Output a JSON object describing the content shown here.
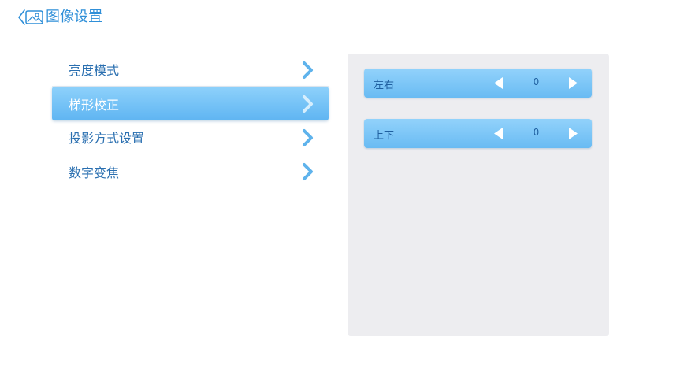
{
  "header": {
    "title": "图像设置",
    "back_icon": "back-image-icon"
  },
  "menu": {
    "items": [
      {
        "label": "亮度模式",
        "selected": false
      },
      {
        "label": "梯形校正",
        "selected": true
      },
      {
        "label": "投影方式设置",
        "selected": false
      },
      {
        "label": "数字变焦",
        "selected": false
      }
    ]
  },
  "panel": {
    "rows": [
      {
        "label": "左右",
        "value": "0"
      },
      {
        "label": "上下",
        "value": "0"
      }
    ]
  },
  "colors": {
    "accent": "#2f8fd8",
    "selected_bg": "#6fc0f5",
    "panel_bg": "#ededf0",
    "chevron": "#5fb3ec",
    "arrow_fill": "#ffffff"
  }
}
